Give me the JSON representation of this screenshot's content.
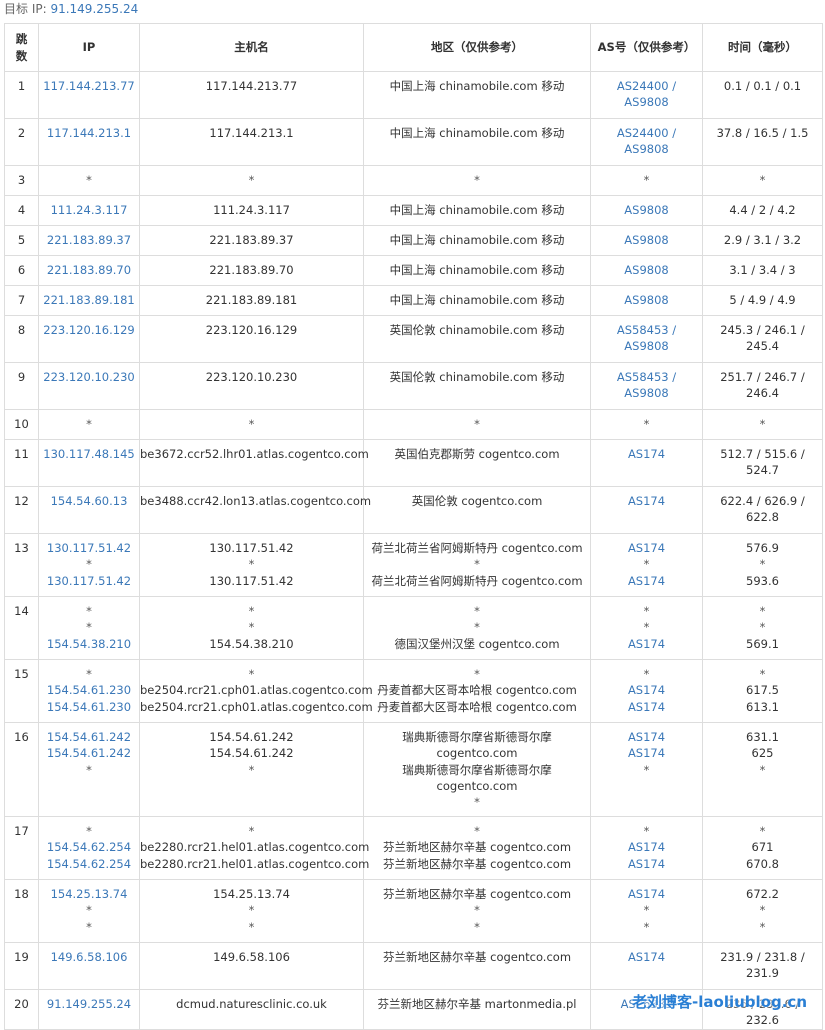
{
  "target": {
    "label": "目标 IP: ",
    "ip": "91.149.255.24"
  },
  "headers": {
    "hop": "跳数",
    "ip": "IP",
    "host": "主机名",
    "loc": "地区（仅供参考）",
    "as": "AS号（仅供参考）",
    "time": "时间（毫秒）"
  },
  "rows": [
    {
      "hop": "1",
      "ip": [
        "117.144.213.77"
      ],
      "host": [
        "117.144.213.77"
      ],
      "loc": [
        "中国上海 chinamobile.com 移动"
      ],
      "as": [
        "AS24400 / AS9808"
      ],
      "time": [
        "0.1 / 0.1 / 0.1"
      ]
    },
    {
      "hop": "2",
      "ip": [
        "117.144.213.1"
      ],
      "host": [
        "117.144.213.1"
      ],
      "loc": [
        "中国上海 chinamobile.com 移动"
      ],
      "as": [
        "AS24400 / AS9808"
      ],
      "time": [
        "37.8 / 16.5 / 1.5"
      ]
    },
    {
      "hop": "3",
      "ip": [
        "*"
      ],
      "host": [
        "*"
      ],
      "loc": [
        "*"
      ],
      "as": [
        "*"
      ],
      "time": [
        "*"
      ]
    },
    {
      "hop": "4",
      "ip": [
        "111.24.3.117"
      ],
      "host": [
        "111.24.3.117"
      ],
      "loc": [
        "中国上海 chinamobile.com 移动"
      ],
      "as": [
        "AS9808"
      ],
      "time": [
        "4.4 / 2 / 4.2"
      ]
    },
    {
      "hop": "5",
      "ip": [
        "221.183.89.37"
      ],
      "host": [
        "221.183.89.37"
      ],
      "loc": [
        "中国上海 chinamobile.com 移动"
      ],
      "as": [
        "AS9808"
      ],
      "time": [
        "2.9 / 3.1 / 3.2"
      ]
    },
    {
      "hop": "6",
      "ip": [
        "221.183.89.70"
      ],
      "host": [
        "221.183.89.70"
      ],
      "loc": [
        "中国上海 chinamobile.com 移动"
      ],
      "as": [
        "AS9808"
      ],
      "time": [
        "3.1 / 3.4 / 3"
      ]
    },
    {
      "hop": "7",
      "ip": [
        "221.183.89.181"
      ],
      "host": [
        "221.183.89.181"
      ],
      "loc": [
        "中国上海 chinamobile.com 移动"
      ],
      "as": [
        "AS9808"
      ],
      "time": [
        "5 / 4.9 / 4.9"
      ]
    },
    {
      "hop": "8",
      "ip": [
        "223.120.16.129"
      ],
      "host": [
        "223.120.16.129"
      ],
      "loc": [
        "英国伦敦 chinamobile.com 移动"
      ],
      "as": [
        "AS58453 / AS9808"
      ],
      "time": [
        "245.3 / 246.1 / 245.4"
      ]
    },
    {
      "hop": "9",
      "ip": [
        "223.120.10.230"
      ],
      "host": [
        "223.120.10.230"
      ],
      "loc": [
        "英国伦敦 chinamobile.com 移动"
      ],
      "as": [
        "AS58453 / AS9808"
      ],
      "time": [
        "251.7 / 246.7 / 246.4"
      ]
    },
    {
      "hop": "10",
      "ip": [
        "*"
      ],
      "host": [
        "*"
      ],
      "loc": [
        "*"
      ],
      "as": [
        "*"
      ],
      "time": [
        "*"
      ]
    },
    {
      "hop": "11",
      "ip": [
        "130.117.48.145"
      ],
      "host": [
        "be3672.ccr52.lhr01.atlas.cogentco.com"
      ],
      "loc": [
        "英国伯克郡斯劳 cogentco.com"
      ],
      "as": [
        "AS174"
      ],
      "time": [
        "512.7 / 515.6 / 524.7"
      ]
    },
    {
      "hop": "12",
      "ip": [
        "154.54.60.13"
      ],
      "host": [
        "be3488.ccr42.lon13.atlas.cogentco.com"
      ],
      "loc": [
        "英国伦敦 cogentco.com"
      ],
      "as": [
        "AS174"
      ],
      "time": [
        "622.4 / 626.9 / 622.8"
      ]
    },
    {
      "hop": "13",
      "ip": [
        "130.117.51.42",
        "*",
        "130.117.51.42"
      ],
      "host": [
        "130.117.51.42",
        "*",
        "130.117.51.42"
      ],
      "loc": [
        "荷兰北荷兰省阿姆斯特丹 cogentco.com",
        "*",
        "荷兰北荷兰省阿姆斯特丹 cogentco.com"
      ],
      "as": [
        "AS174",
        "*",
        "AS174"
      ],
      "time": [
        "576.9",
        "*",
        "593.6"
      ]
    },
    {
      "hop": "14",
      "ip": [
        "*",
        "*",
        "154.54.38.210"
      ],
      "host": [
        "*",
        "*",
        "154.54.38.210"
      ],
      "loc": [
        "*",
        "*",
        "德国汉堡州汉堡 cogentco.com"
      ],
      "as": [
        "*",
        "*",
        "AS174"
      ],
      "time": [
        "*",
        "*",
        "569.1"
      ]
    },
    {
      "hop": "15",
      "ip": [
        "*",
        "154.54.61.230",
        "154.54.61.230"
      ],
      "host": [
        "*",
        "be2504.rcr21.cph01.atlas.cogentco.com",
        "be2504.rcr21.cph01.atlas.cogentco.com"
      ],
      "loc": [
        "*",
        "丹麦首都大区哥本哈根 cogentco.com",
        "丹麦首都大区哥本哈根 cogentco.com"
      ],
      "as": [
        "*",
        "AS174",
        "AS174"
      ],
      "time": [
        "*",
        "617.5",
        "613.1"
      ]
    },
    {
      "hop": "16",
      "ip": [
        "154.54.61.242",
        "154.54.61.242",
        "*"
      ],
      "host": [
        "154.54.61.242",
        "154.54.61.242",
        "*"
      ],
      "loc": [
        "瑞典斯德哥尔摩省斯德哥尔摩",
        "cogentco.com",
        "瑞典斯德哥尔摩省斯德哥尔摩",
        "cogentco.com",
        "*"
      ],
      "as": [
        "AS174",
        "AS174",
        "*"
      ],
      "time": [
        "631.1",
        "625",
        "*"
      ]
    },
    {
      "hop": "17",
      "ip": [
        "*",
        "154.54.62.254",
        "154.54.62.254"
      ],
      "host": [
        "*",
        "be2280.rcr21.hel01.atlas.cogentco.com",
        "be2280.rcr21.hel01.atlas.cogentco.com"
      ],
      "loc": [
        "*",
        "芬兰新地区赫尔辛基 cogentco.com",
        "芬兰新地区赫尔辛基 cogentco.com"
      ],
      "as": [
        "*",
        "AS174",
        "AS174"
      ],
      "time": [
        "*",
        "671",
        "670.8"
      ]
    },
    {
      "hop": "18",
      "ip": [
        "154.25.13.74",
        "*",
        "*"
      ],
      "host": [
        "154.25.13.74",
        "*",
        "*"
      ],
      "loc": [
        "芬兰新地区赫尔辛基 cogentco.com",
        "*",
        "*"
      ],
      "as": [
        "AS174",
        "*",
        "*"
      ],
      "time": [
        "672.2",
        "*",
        "*"
      ]
    },
    {
      "hop": "19",
      "ip": [
        "149.6.58.106"
      ],
      "host": [
        "149.6.58.106"
      ],
      "loc": [
        "芬兰新地区赫尔辛基 cogentco.com"
      ],
      "as": [
        "AS174"
      ],
      "time": [
        "231.9 / 231.8 / 231.9"
      ]
    },
    {
      "hop": "20",
      "ip": [
        "91.149.255.24"
      ],
      "host": [
        "dcmud.naturesclinic.co.uk"
      ],
      "loc": [
        "芬兰新地区赫尔辛基 martonmedia.pl"
      ],
      "as": [
        "AS26383"
      ],
      "time": [
        "235 / 232.6 / 232.6"
      ]
    }
  ],
  "watermark": "老刘博客-laoliublog.cn"
}
